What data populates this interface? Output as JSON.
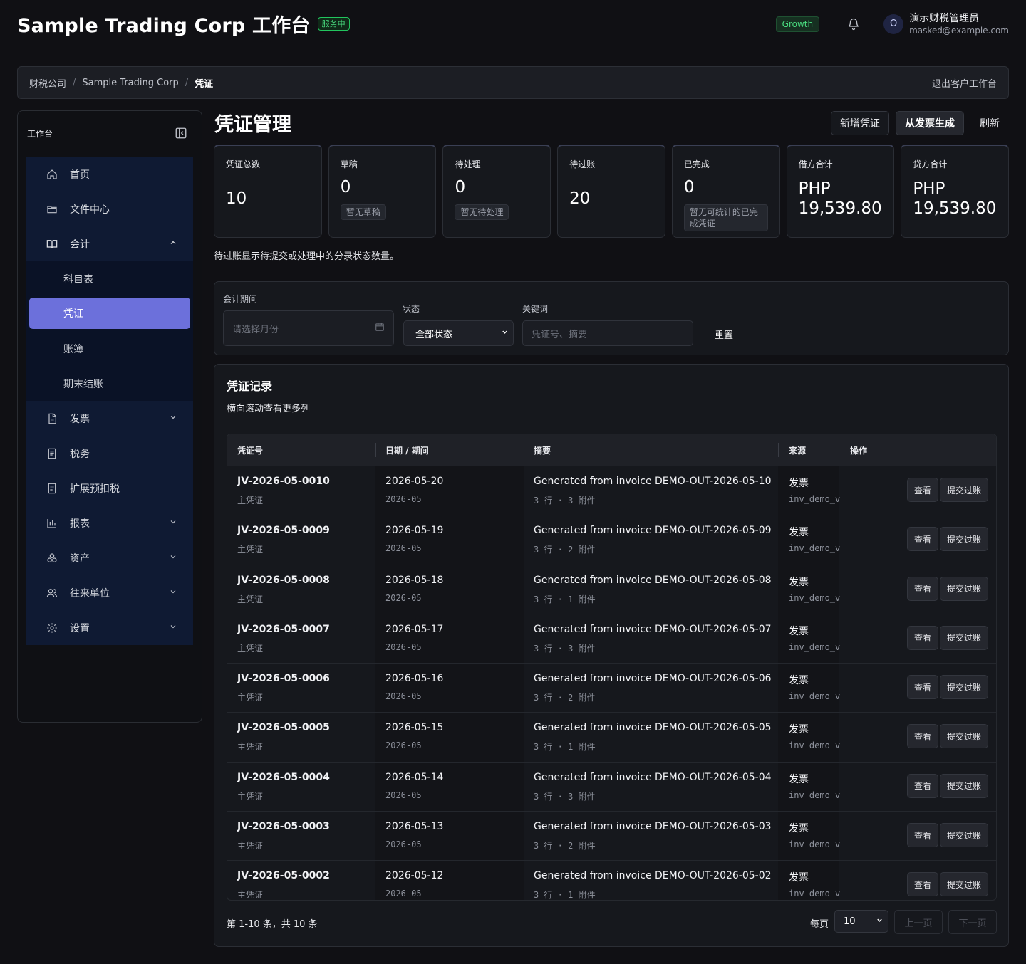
{
  "header": {
    "title": "Sample Trading Corp 工作台",
    "status": "服务中",
    "plan": "Growth",
    "user": {
      "initial": "O",
      "name": "演示财税管理员",
      "email": "masked@example.com"
    }
  },
  "breadcrumb": {
    "items": [
      "财税公司",
      "Sample Trading Corp",
      "凭证"
    ],
    "exit": "退出客户工作台"
  },
  "sidebar": {
    "title": "工作台",
    "items": [
      {
        "label": "首页",
        "icon": "home-icon"
      },
      {
        "label": "文件中心",
        "icon": "folder-icon"
      },
      {
        "label": "会计",
        "icon": "book-icon",
        "expanded": true,
        "children": [
          "科目表",
          "凭证",
          "账簿",
          "期末结账"
        ],
        "active_child": "凭证"
      },
      {
        "label": "发票",
        "icon": "document-icon"
      },
      {
        "label": "税务",
        "icon": "receipt-icon"
      },
      {
        "label": "扩展预扣税",
        "icon": "receipt-icon"
      },
      {
        "label": "报表",
        "icon": "bar-chart-icon"
      },
      {
        "label": "资产",
        "icon": "assets-icon"
      },
      {
        "label": "往来单位",
        "icon": "users-icon"
      },
      {
        "label": "设置",
        "icon": "gear-icon"
      }
    ]
  },
  "page": {
    "title": "凭证管理",
    "actions": {
      "new": "新增凭证",
      "from_invoice": "从发票生成",
      "refresh": "刷新"
    }
  },
  "stats": [
    {
      "label": "凭证总数",
      "value": "10"
    },
    {
      "label": "草稿",
      "value": "0",
      "hint": "暂无草稿"
    },
    {
      "label": "待处理",
      "value": "0",
      "hint": "暂无待处理"
    },
    {
      "label": "待过账",
      "value": "20"
    },
    {
      "label": "已完成",
      "value": "0",
      "hint": "暂无可统计的已完成凭证"
    },
    {
      "label": "借方合计",
      "value": "PHP 19,539.80"
    },
    {
      "label": "贷方合计",
      "value": "PHP 19,539.80"
    }
  ],
  "stats_note": "待过账显示待提交或处理中的分录状态数量。",
  "filters": {
    "period_label": "会计期间",
    "period_placeholder": "请选择月份",
    "status_label": "状态",
    "status_value": "全部状态",
    "keyword_label": "关键词",
    "keyword_placeholder": "凭证号、摘要",
    "reset": "重置"
  },
  "records": {
    "title": "凭证记录",
    "subtitle": "横向滚动查看更多列",
    "columns": [
      "凭证号",
      "日期 / 期间",
      "摘要",
      "来源",
      "操作"
    ],
    "view_label": "查看",
    "submit_label": "提交过账",
    "rows": [
      {
        "no": "JV-2026-05-0010",
        "type": "主凭证",
        "date": "2026-05-20",
        "period": "2026-05",
        "summary": "Generated from invoice DEMO-OUT-2026-05-10",
        "meta": "3 行 · 3 附件",
        "source": "发票",
        "ref": "inv_demo_v"
      },
      {
        "no": "JV-2026-05-0009",
        "type": "主凭证",
        "date": "2026-05-19",
        "period": "2026-05",
        "summary": "Generated from invoice DEMO-OUT-2026-05-09",
        "meta": "3 行 · 2 附件",
        "source": "发票",
        "ref": "inv_demo_v"
      },
      {
        "no": "JV-2026-05-0008",
        "type": "主凭证",
        "date": "2026-05-18",
        "period": "2026-05",
        "summary": "Generated from invoice DEMO-OUT-2026-05-08",
        "meta": "3 行 · 1 附件",
        "source": "发票",
        "ref": "inv_demo_v"
      },
      {
        "no": "JV-2026-05-0007",
        "type": "主凭证",
        "date": "2026-05-17",
        "period": "2026-05",
        "summary": "Generated from invoice DEMO-OUT-2026-05-07",
        "meta": "3 行 · 3 附件",
        "source": "发票",
        "ref": "inv_demo_v"
      },
      {
        "no": "JV-2026-05-0006",
        "type": "主凭证",
        "date": "2026-05-16",
        "period": "2026-05",
        "summary": "Generated from invoice DEMO-OUT-2026-05-06",
        "meta": "3 行 · 2 附件",
        "source": "发票",
        "ref": "inv_demo_v"
      },
      {
        "no": "JV-2026-05-0005",
        "type": "主凭证",
        "date": "2026-05-15",
        "period": "2026-05",
        "summary": "Generated from invoice DEMO-OUT-2026-05-05",
        "meta": "3 行 · 1 附件",
        "source": "发票",
        "ref": "inv_demo_v"
      },
      {
        "no": "JV-2026-05-0004",
        "type": "主凭证",
        "date": "2026-05-14",
        "period": "2026-05",
        "summary": "Generated from invoice DEMO-OUT-2026-05-04",
        "meta": "3 行 · 3 附件",
        "source": "发票",
        "ref": "inv_demo_v"
      },
      {
        "no": "JV-2026-05-0003",
        "type": "主凭证",
        "date": "2026-05-13",
        "period": "2026-05",
        "summary": "Generated from invoice DEMO-OUT-2026-05-03",
        "meta": "3 行 · 2 附件",
        "source": "发票",
        "ref": "inv_demo_v"
      },
      {
        "no": "JV-2026-05-0002",
        "type": "主凭证",
        "date": "2026-05-12",
        "period": "2026-05",
        "summary": "Generated from invoice DEMO-OUT-2026-05-02",
        "meta": "3 行 · 1 附件",
        "source": "发票",
        "ref": "inv_demo_v"
      }
    ]
  },
  "pagination": {
    "info": "第 1-10 条，共 10 条",
    "per_page_label": "每页",
    "per_page": "10",
    "prev": "上一页",
    "next": "下一页"
  },
  "colors": {
    "accent": "#6c70db",
    "success": "#4ade80"
  }
}
